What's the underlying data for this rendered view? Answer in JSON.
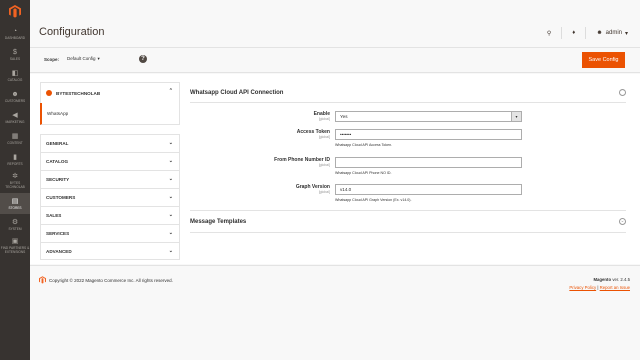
{
  "nav": {
    "items": [
      {
        "label": "Dashboard",
        "icon": "dashboard-icon",
        "glyph": "◔"
      },
      {
        "label": "Sales",
        "icon": "dollar-icon",
        "glyph": "$"
      },
      {
        "label": "Catalog",
        "icon": "box-icon",
        "glyph": "◧"
      },
      {
        "label": "Customers",
        "icon": "people-icon",
        "glyph": "☻"
      },
      {
        "label": "Marketing",
        "icon": "megaphone-icon",
        "glyph": "◀"
      },
      {
        "label": "Content",
        "icon": "content-icon",
        "glyph": "▦"
      },
      {
        "label": "Reports",
        "icon": "chart-icon",
        "glyph": "▮"
      },
      {
        "label": "Bytes Technolab",
        "icon": "gear-icon",
        "glyph": "✲"
      },
      {
        "label": "Stores",
        "icon": "stores-icon",
        "glyph": "▤"
      },
      {
        "label": "System",
        "icon": "system-icon",
        "glyph": "⚙"
      },
      {
        "label": "Find Partners & Extensions",
        "icon": "partners-icon",
        "glyph": "▣"
      }
    ]
  },
  "header": {
    "title": "Configuration",
    "user": "admin"
  },
  "scope": {
    "label": "Scope:",
    "value": "Default Config"
  },
  "toolbar": {
    "save_label": "Save Config"
  },
  "tabs": {
    "vendor": "BYTESTECHNOLAB",
    "vendor_item": "WhatsApp",
    "groups": [
      "GENERAL",
      "CATALOG",
      "SECURITY",
      "CUSTOMERS",
      "SALES",
      "SERVICES",
      "ADVANCED"
    ]
  },
  "section": {
    "title": "Whatsapp Cloud API Connection",
    "fields": [
      {
        "label": "Enable",
        "scope": "[global]",
        "value": "Yes",
        "note": ""
      },
      {
        "label": "Access Token",
        "scope": "[global]",
        "value": "•••••••",
        "note": "Whatsapp Cloud API Access Token."
      },
      {
        "label": "From Phone Number ID",
        "scope": "[global]",
        "value": "",
        "note": "Whatsapp Cloud API Phone NO ID."
      },
      {
        "label": "Graph Version",
        "scope": "[global]",
        "value": "v14.0",
        "note": "Whatsapp Cloud API Graph Version (Ex. v14.0)."
      }
    ]
  },
  "subsection": {
    "title": "Message Templates"
  },
  "footer": {
    "copyright": "Copyright © 2022 Magento Commerce Inc. All rights reserved.",
    "version_label": "Magento",
    "version": "ver. 2.4.5",
    "privacy": "Privacy Policy",
    "separator": "|",
    "report": "Report an Issue"
  },
  "colors": {
    "accent": "#eb5202",
    "nav_bg": "#373330"
  }
}
